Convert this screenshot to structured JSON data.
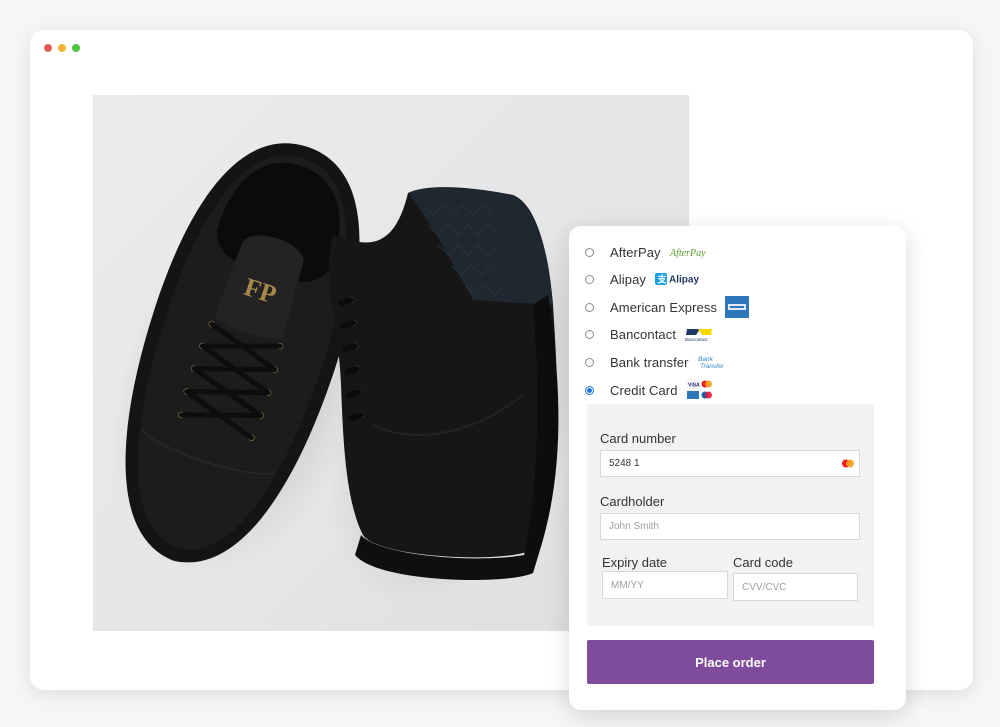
{
  "window": {
    "dot_colors": [
      "#ee5b50",
      "#f2b43a",
      "#50c23f"
    ]
  },
  "product_image": {
    "icon": "sneakers-photo",
    "brand_mark": "FP"
  },
  "payment_methods": [
    {
      "label": "AfterPay",
      "logo": "afterpay-logo",
      "logo_text": "AfterPay",
      "selected": false
    },
    {
      "label": "Alipay",
      "logo": "alipay-logo",
      "logo_text": "Alipay",
      "selected": false
    },
    {
      "label": "American Express",
      "logo": "amex-logo",
      "selected": false
    },
    {
      "label": "Bancontact",
      "logo": "bancontact-logo",
      "logo_text": "Bancontact",
      "selected": false
    },
    {
      "label": "Bank transfer",
      "logo": "bank-transfer-logo",
      "logo_text": "Bank\nTransfer",
      "selected": false
    },
    {
      "label": "Credit Card",
      "logo": "credit-card-logos",
      "selected": true
    }
  ],
  "card_form": {
    "card_number_label": "Card number",
    "card_number_value": "5248 1",
    "cardholder_label": "Cardholder",
    "cardholder_placeholder": "John Smith",
    "expiry_label": "Expiry date",
    "expiry_placeholder": "MM/YY",
    "code_label": "Card code",
    "code_placeholder": "CVV/CVC"
  },
  "place_order_label": "Place order",
  "colors": {
    "button": "#7f4b9b",
    "radio_selected": "#1a73e8",
    "form_background": "#f1f2f4"
  }
}
